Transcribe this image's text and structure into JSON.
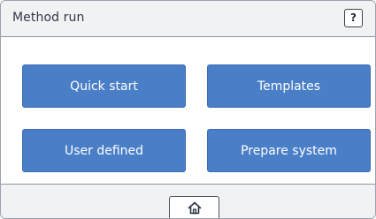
{
  "header": {
    "title": "Method run",
    "help_label": "?"
  },
  "main": {
    "tiles": [
      {
        "label": "Quick start"
      },
      {
        "label": "Templates"
      },
      {
        "label": "User defined"
      },
      {
        "label": "Prepare system"
      }
    ]
  },
  "footer": {
    "home_icon": "home-icon"
  },
  "colors": {
    "tile_blue": "#4a7fc8",
    "bar_gray": "#f1f2f4",
    "title_text": "#2f3947"
  }
}
